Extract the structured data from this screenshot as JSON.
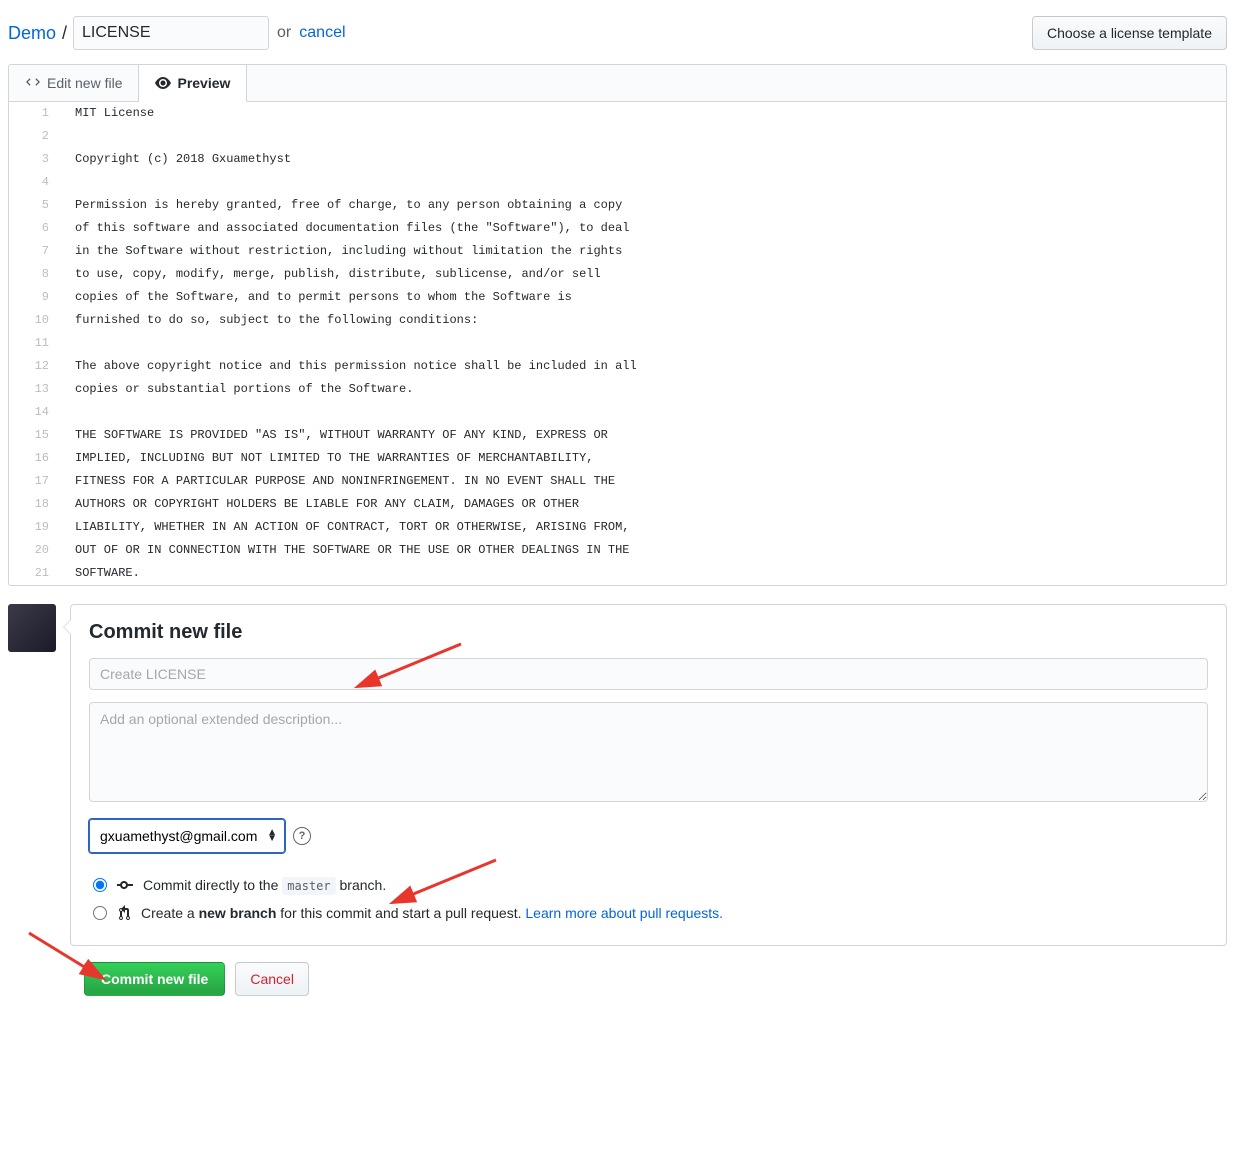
{
  "header": {
    "repo_name": "Demo",
    "filename_value": "LICENSE",
    "or_text": "or",
    "cancel_text": "cancel",
    "template_button": "Choose a license template"
  },
  "tabs": {
    "edit": "Edit new file",
    "preview": "Preview"
  },
  "code_lines": [
    "MIT License",
    "",
    "Copyright (c) 2018 Gxuamethyst",
    "",
    "Permission is hereby granted, free of charge, to any person obtaining a copy",
    "of this software and associated documentation files (the \"Software\"), to deal",
    "in the Software without restriction, including without limitation the rights",
    "to use, copy, modify, merge, publish, distribute, sublicense, and/or sell",
    "copies of the Software, and to permit persons to whom the Software is",
    "furnished to do so, subject to the following conditions:",
    "",
    "The above copyright notice and this permission notice shall be included in all",
    "copies or substantial portions of the Software.",
    "",
    "THE SOFTWARE IS PROVIDED \"AS IS\", WITHOUT WARRANTY OF ANY KIND, EXPRESS OR",
    "IMPLIED, INCLUDING BUT NOT LIMITED TO THE WARRANTIES OF MERCHANTABILITY,",
    "FITNESS FOR A PARTICULAR PURPOSE AND NONINFRINGEMENT. IN NO EVENT SHALL THE",
    "AUTHORS OR COPYRIGHT HOLDERS BE LIABLE FOR ANY CLAIM, DAMAGES OR OTHER",
    "LIABILITY, WHETHER IN AN ACTION OF CONTRACT, TORT OR OTHERWISE, ARISING FROM,",
    "OUT OF OR IN CONNECTION WITH THE SOFTWARE OR THE USE OR OTHER DEALINGS IN THE",
    "SOFTWARE."
  ],
  "commit": {
    "heading": "Commit new file",
    "summary_placeholder": "Create LICENSE",
    "description_placeholder": "Add an optional extended description...",
    "email": "gxuamethyst@gmail.com",
    "radio_direct_pre": "Commit directly to the ",
    "radio_direct_branch": "master",
    "radio_direct_post": " branch.",
    "radio_newbranch_pre": "Create a ",
    "radio_newbranch_bold": "new branch",
    "radio_newbranch_post": " for this commit and start a pull request. ",
    "learn_more": "Learn more about pull requests.",
    "commit_button": "Commit new file",
    "cancel_button": "Cancel"
  }
}
